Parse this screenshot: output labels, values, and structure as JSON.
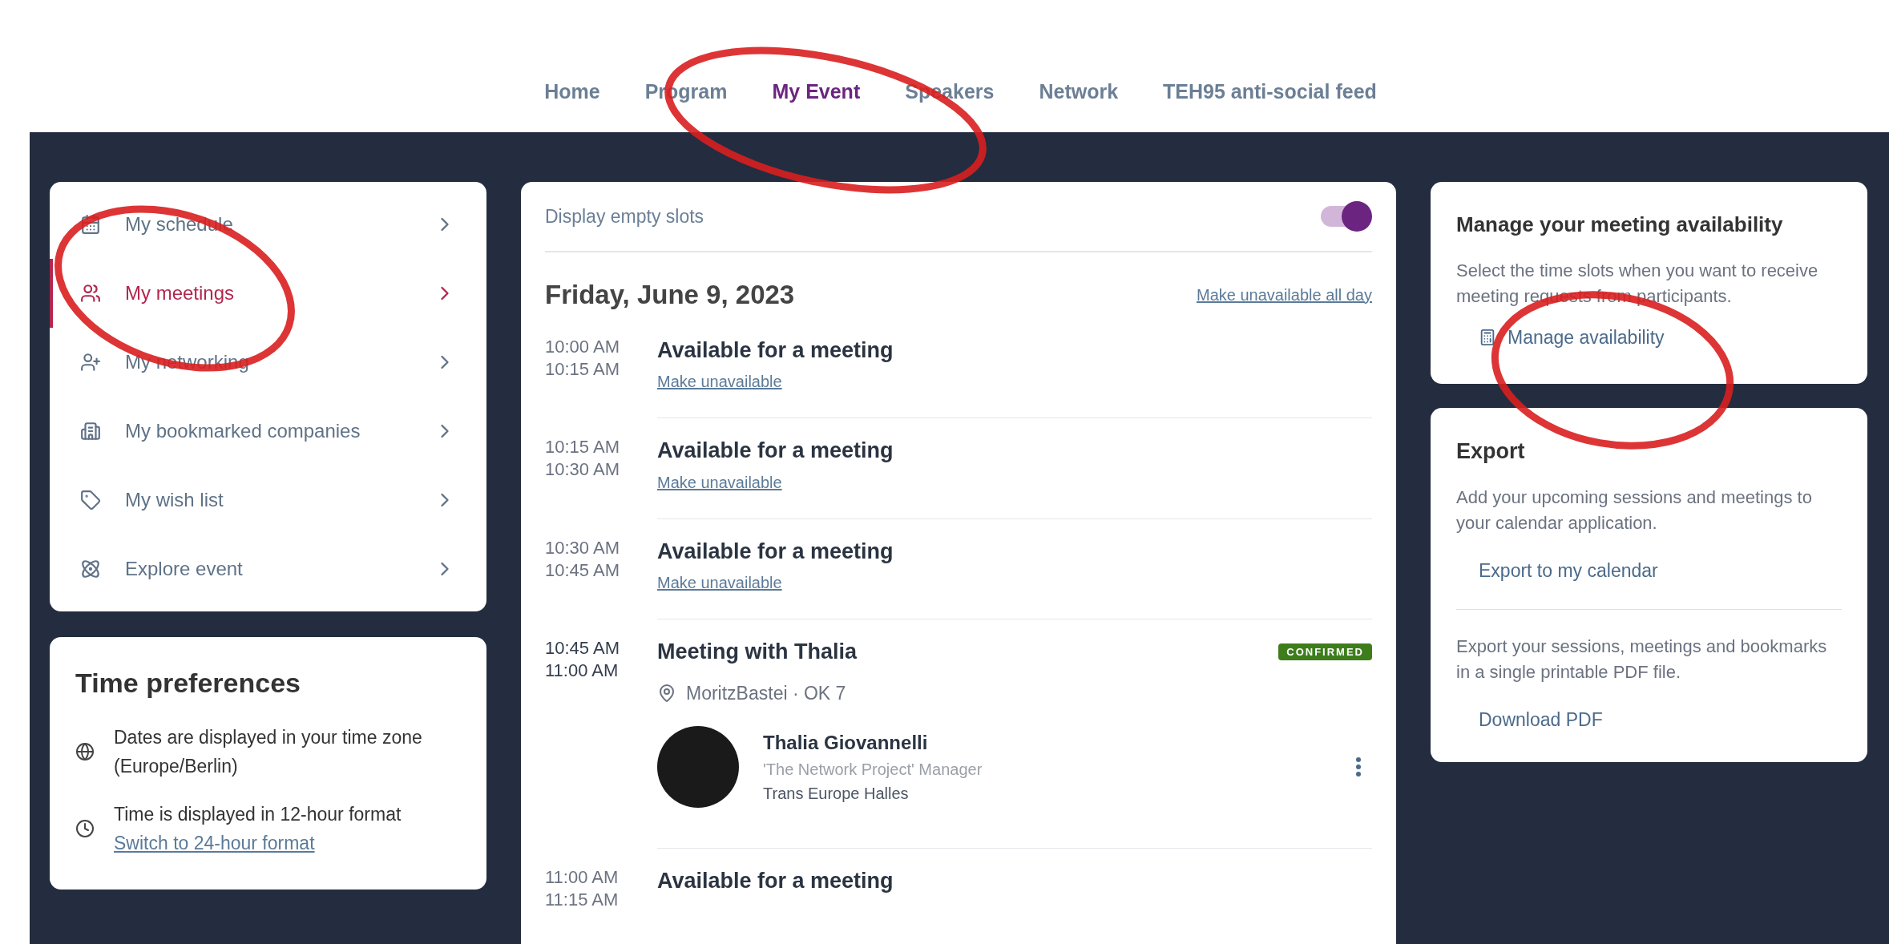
{
  "nav": [
    {
      "label": "Home",
      "selected": false
    },
    {
      "label": "Program",
      "selected": false
    },
    {
      "label": "My Event",
      "selected": true
    },
    {
      "label": "Speakers",
      "selected": false
    },
    {
      "label": "Network",
      "selected": false
    },
    {
      "label": "TEH95 anti-social feed",
      "selected": false
    }
  ],
  "sidebar": {
    "items": [
      {
        "label": "My schedule",
        "selected": false
      },
      {
        "label": "My meetings",
        "selected": true
      },
      {
        "label": "My networking",
        "selected": false
      },
      {
        "label": "My bookmarked companies",
        "selected": false
      },
      {
        "label": "My wish list",
        "selected": false
      },
      {
        "label": "Explore event",
        "selected": false
      }
    ]
  },
  "time_preferences": {
    "title": "Time preferences",
    "items": [
      {
        "text": "Dates are displayed in your time zone (Europe/Berlin)"
      },
      {
        "text": "Time is displayed in 12-hour format",
        "link": "Switch to 24-hour format"
      }
    ]
  },
  "schedule": {
    "toggle": {
      "label": "Display empty slots",
      "on": true
    },
    "date": "Friday, June 9, 2023",
    "all_day_link": "Make unavailable all day",
    "slots": [
      {
        "kind": "available",
        "start": "10:00 AM",
        "end": "10:15 AM",
        "title": "Available for a meeting",
        "link": "Make unavailable"
      },
      {
        "kind": "available",
        "start": "10:15 AM",
        "end": "10:30 AM",
        "title": "Available for a meeting",
        "link": "Make unavailable"
      },
      {
        "kind": "available",
        "start": "10:30 AM",
        "end": "10:45 AM",
        "title": "Available for a meeting",
        "link": "Make unavailable"
      },
      {
        "kind": "meeting",
        "start": "10:45 AM",
        "end": "11:00 AM",
        "title": "Meeting with Thalia",
        "status": "CONFIRMED",
        "location": "MoritzBastei · OK 7",
        "person": {
          "name": "Thalia Giovannelli",
          "role": "'The Network Project' Manager",
          "company": "Trans Europe Halles"
        }
      },
      {
        "kind": "available",
        "start": "11:00 AM",
        "end": "11:15 AM",
        "title": "Available for a meeting"
      }
    ]
  },
  "availability": {
    "title": "Manage your meeting availability",
    "text": "Select the time slots when you want to receive meeting requests from participants.",
    "button": "Manage availability"
  },
  "export": {
    "title": "Export",
    "sections": [
      {
        "text": "Add your upcoming sessions and meetings to your calendar application.",
        "link": "Export to my calendar"
      },
      {
        "text": "Export your sessions, meetings and bookmarks in a single printable PDF file.",
        "link": "Download PDF"
      }
    ]
  }
}
